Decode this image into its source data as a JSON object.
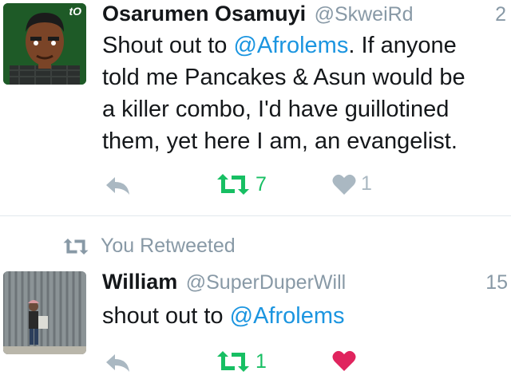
{
  "tweet1": {
    "avatar_badge": "tO",
    "display_name": "Osarumen Osamuyi",
    "handle": "@SkweiRd",
    "time": "2",
    "text_lines": [
      {
        "pre": "Shout out to ",
        "mention": "@Afrolems",
        "post": ". If anyone"
      },
      {
        "text": "told me Pancakes & Asun would be"
      },
      {
        "text": "a killer combo, I'd have guillotined"
      },
      {
        "text": "them, yet here I am, an evangelist."
      }
    ],
    "retweet_count": "7",
    "like_count": "1",
    "liked": false
  },
  "retweet_context": {
    "label": "You Retweeted"
  },
  "tweet2": {
    "display_name": "William",
    "handle": "@SuperDuperWill",
    "time": "15",
    "text_pre": "shout out to ",
    "text_mention": "@Afrolems",
    "retweet_count": "1",
    "liked": true
  },
  "colors": {
    "retweet_green": "#17bf63",
    "like_red": "#e0245e",
    "link_blue": "#1b95e0",
    "muted_gray": "#8899a6",
    "icon_gray": "#aab8c2"
  }
}
